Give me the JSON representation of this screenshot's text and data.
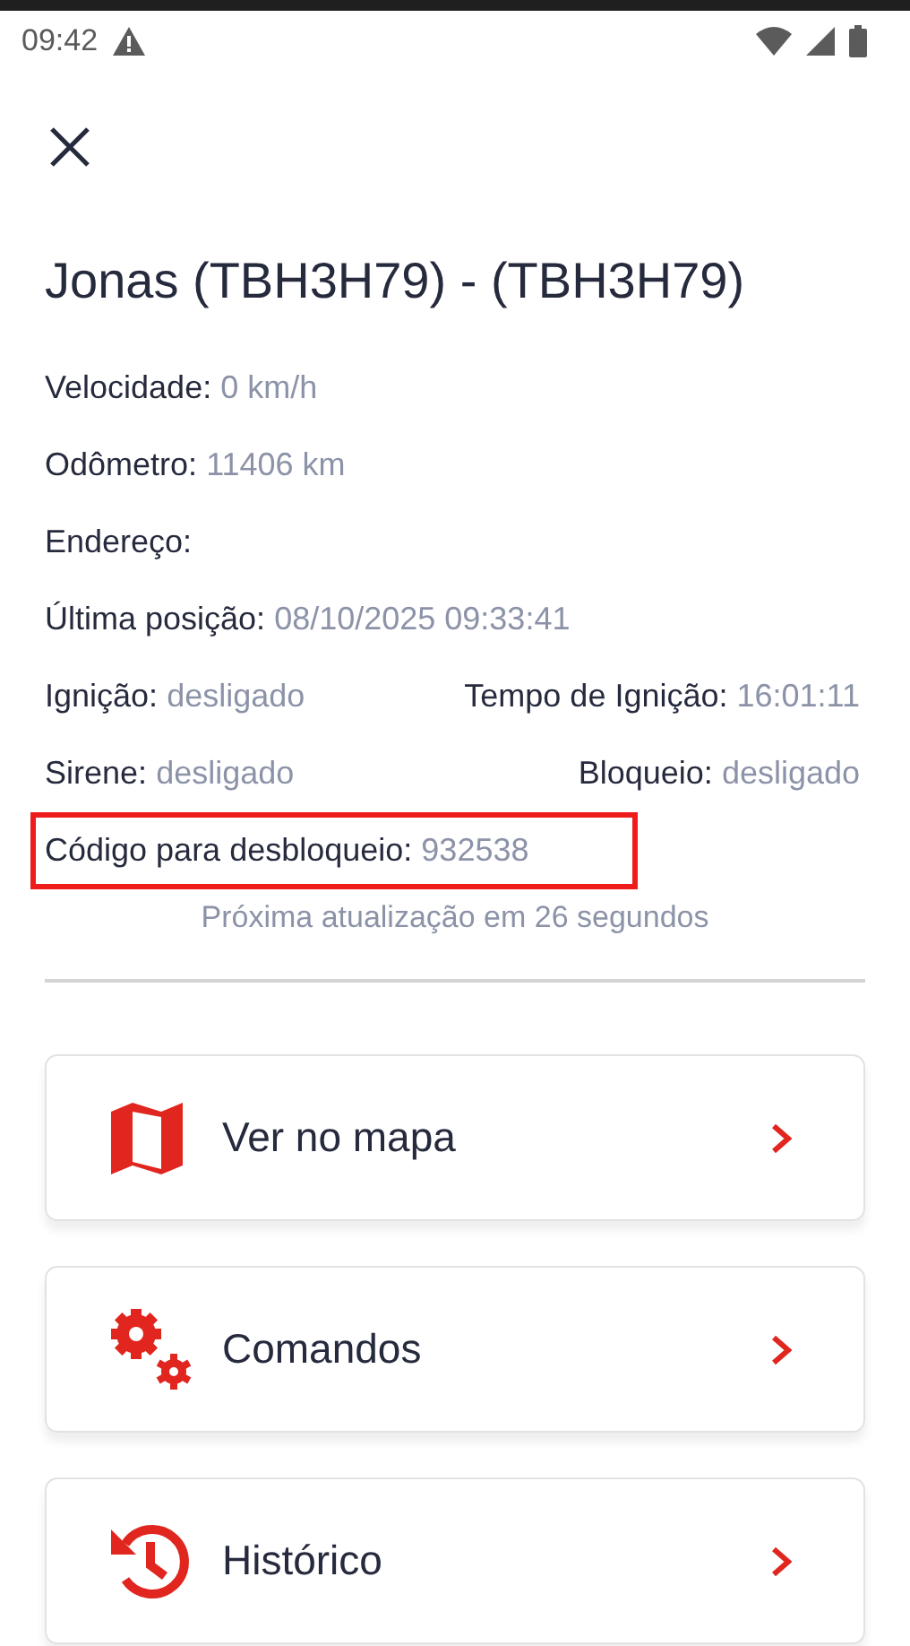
{
  "status_bar": {
    "time": "09:42"
  },
  "title": "Jonas (TBH3H79) - (TBH3H79)",
  "details": [
    {
      "highlighted": false,
      "items": [
        {
          "label": "Velocidade:",
          "value": "0 km/h"
        }
      ]
    },
    {
      "highlighted": false,
      "items": [
        {
          "label": "Odômetro:",
          "value": "11406 km"
        }
      ]
    },
    {
      "highlighted": false,
      "items": [
        {
          "label": "Endereço:"
        }
      ]
    },
    {
      "highlighted": false,
      "items": [
        {
          "label": "Última posição:",
          "value": "08/10/2025 09:33:41"
        }
      ]
    },
    {
      "highlighted": false,
      "items": [
        {
          "label": "Ignição:",
          "value": "desligado"
        },
        {
          "label": "Tempo de Ignição:",
          "value": "16:01:11"
        }
      ]
    },
    {
      "highlighted": false,
      "items": [
        {
          "label": "Sirene:",
          "value": "desligado"
        },
        {
          "label": "Bloqueio:",
          "value": "desligado"
        }
      ]
    },
    {
      "highlighted": true,
      "items": [
        {
          "label": "Código para desbloqueio:",
          "value": "932538"
        }
      ]
    }
  ],
  "next_update": "Próxima atualização em 26 segundos",
  "menu": [
    {
      "kind": "map",
      "label": "Ver no mapa"
    },
    {
      "kind": "gears",
      "label": "Comandos"
    },
    {
      "kind": "history",
      "label": "Histórico"
    }
  ]
}
